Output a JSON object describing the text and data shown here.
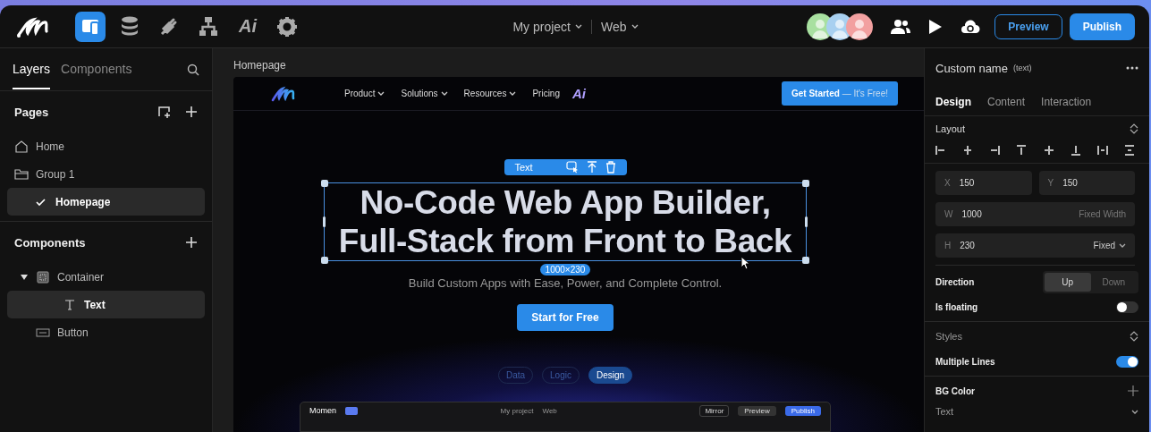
{
  "toolbar": {
    "tools": [
      {
        "kind": "pages",
        "selected": true
      },
      {
        "kind": "data",
        "selected": false
      },
      {
        "kind": "plugin",
        "selected": false
      },
      {
        "kind": "hierarchy",
        "selected": false
      },
      {
        "kind": "ai",
        "label": "Ai",
        "selected": false
      },
      {
        "kind": "settings",
        "selected": false
      }
    ],
    "project": "My project",
    "platform": "Web",
    "avatars": [
      {
        "color": "#a8e0a0"
      },
      {
        "color": "#a8d0f0"
      },
      {
        "color": "#f2a0a0"
      }
    ],
    "preview": "Preview",
    "publish": "Publish"
  },
  "left": {
    "tabs": [
      {
        "label": "Layers",
        "selected": true
      },
      {
        "label": "Components",
        "selected": false
      }
    ],
    "pages_title": "Pages",
    "pages": [
      {
        "kind": "home",
        "label": "Home",
        "selected": false
      },
      {
        "kind": "folder",
        "label": "Group 1",
        "selected": false
      },
      {
        "kind": "page",
        "label": "Homepage",
        "selected": true
      }
    ],
    "components_title": "Components",
    "components": [
      {
        "kind": "container",
        "label": "Container",
        "selected": false,
        "expanded": true,
        "children": [
          {
            "kind": "text",
            "label": "Text",
            "selected": true
          }
        ]
      },
      {
        "kind": "button",
        "label": "Button",
        "selected": false
      }
    ]
  },
  "canvas": {
    "breadcrumb": "Homepage",
    "nav": [
      {
        "label": "Product",
        "dropdown": true
      },
      {
        "label": "Solutions",
        "dropdown": true
      },
      {
        "label": "Resources",
        "dropdown": true
      },
      {
        "label": "Pricing",
        "dropdown": false
      }
    ],
    "nav_ai": "Ai",
    "cta": "Get Started",
    "cta_note": "— It's Free!",
    "selection_label": "Text",
    "size_badge": "1000×230",
    "headline": [
      "No-Code Web App Builder,",
      "Full-Stack from Front to Back"
    ],
    "subtitle": "Build Custom Apps with Ease, Power, and Complete Control.",
    "start": "Start for Free",
    "pills": [
      {
        "label": "Data",
        "selected": false
      },
      {
        "label": "Logic",
        "selected": false
      },
      {
        "label": "Design",
        "selected": true
      }
    ],
    "mini": {
      "logo": "Momen",
      "project": "My project",
      "platform": "Web",
      "mirror": "Mirror",
      "preview": "Preview",
      "publish": "Publish"
    }
  },
  "right": {
    "title": "Custom name",
    "type": "(text)",
    "tabs": [
      {
        "label": "Design",
        "selected": true
      },
      {
        "label": "Content",
        "selected": false
      },
      {
        "label": "Interaction",
        "selected": false
      }
    ],
    "layout_title": "Layout",
    "fields": [
      {
        "label": "X",
        "value": "150"
      },
      {
        "label": "Y",
        "value": "150"
      },
      {
        "label": "W",
        "value": "1000",
        "note": "Fixed Width"
      },
      {
        "label": "H",
        "value": "230",
        "note": "Fixed",
        "dropdown": true
      }
    ],
    "direction": {
      "label": "Direction",
      "options": [
        {
          "label": "Up",
          "selected": true
        },
        {
          "label": "Down",
          "selected": false
        }
      ]
    },
    "floating": {
      "label": "Is floating",
      "on": false
    },
    "styles_title": "Styles",
    "multiline": {
      "label": "Multiple Lines",
      "on": true
    },
    "bg_color": "BG Color",
    "text_title": "Text"
  }
}
